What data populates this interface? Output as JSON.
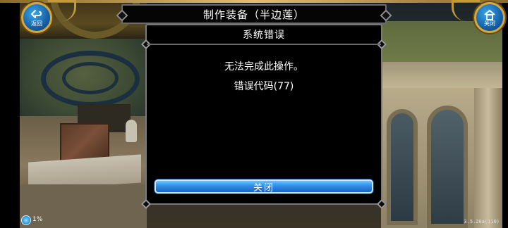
{
  "header": {
    "title": "制作装备（半边莲）",
    "back_label": "返回",
    "close_label": "关闭"
  },
  "dialog": {
    "title": "系统错误",
    "message": "无法完成此操作。",
    "error_code": "错误代码(77)",
    "confirm_label": "关闭"
  },
  "status": {
    "indicator_text": "1%",
    "version": "3.5.20a(110)"
  },
  "colors": {
    "button_blue": "#2f8ee8",
    "frame_gold": "#d4a840",
    "dialog_bg": "#000000"
  },
  "icons": {
    "back": "back-arrow-icon",
    "close": "home-icon",
    "status": "network-status-icon"
  }
}
